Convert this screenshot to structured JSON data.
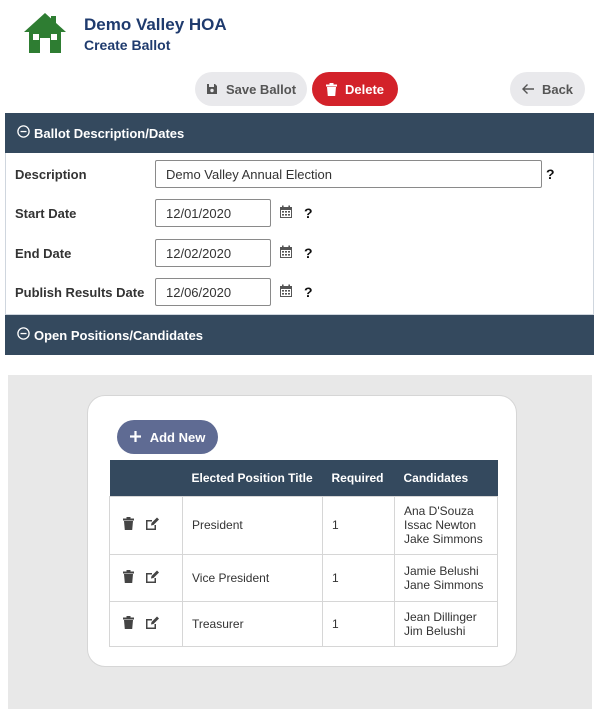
{
  "header": {
    "org_name": "Demo Valley HOA",
    "page_title": "Create Ballot"
  },
  "toolbar": {
    "save_label": "Save Ballot",
    "delete_label": "Delete",
    "back_label": "Back"
  },
  "ballot_section": {
    "title": "Ballot Description/Dates",
    "fields": [
      {
        "label": "Description",
        "value": "Demo Valley Annual Election"
      },
      {
        "label": "Start Date",
        "value": "12/01/2020"
      },
      {
        "label": "End Date",
        "value": "12/02/2020"
      },
      {
        "label": "Publish Results Date",
        "value": "12/06/2020"
      }
    ],
    "help_glyph": "?"
  },
  "positions_section": {
    "title": "Open Positions/Candidates",
    "add_label": "Add New",
    "columns": [
      "",
      "Elected Position Title",
      "Required",
      "Candidates"
    ],
    "rows": [
      {
        "title": "President",
        "required": "1",
        "candidates": [
          "Ana D'Souza",
          "Issac Newton",
          "Jake Simmons"
        ]
      },
      {
        "title": "Vice President",
        "required": "1",
        "candidates": [
          "Jamie Belushi",
          "Jane Simmons"
        ]
      },
      {
        "title": "Treasurer",
        "required": "1",
        "candidates": [
          "Jean Dillinger",
          "Jim Belushi"
        ]
      }
    ]
  },
  "colors": {
    "brand": "#1f3b6e",
    "header_bar": "#34495e",
    "delete": "#d3222a",
    "add": "#5f6b93",
    "logo": "#2e7d32"
  },
  "icons": {
    "logo": "house-icon",
    "save": "floppy-disk-icon",
    "delete": "trash-icon",
    "back": "arrow-left-icon",
    "collapse": "minus-circle-icon",
    "calendar": "calendar-icon",
    "add": "plus-icon",
    "row_delete": "trash-icon",
    "row_edit": "edit-icon"
  }
}
